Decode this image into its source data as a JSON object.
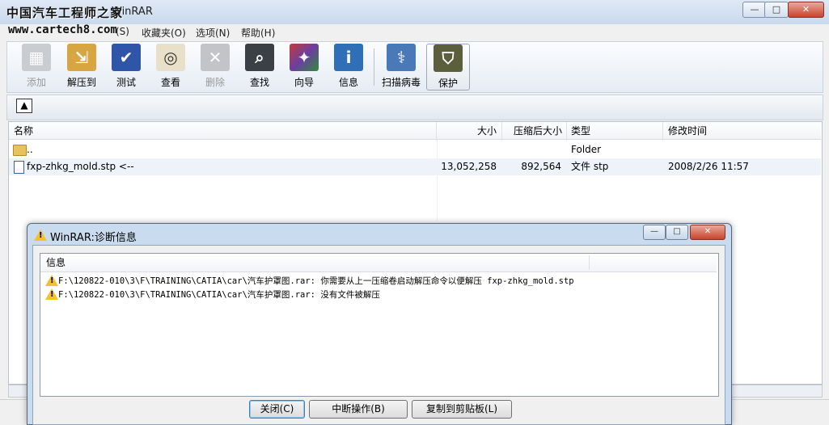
{
  "window": {
    "watermark": "中国汽车工程师之家",
    "title": "WinRAR",
    "url_watermark": "www.cartech8.com",
    "controls": {
      "minimize": "—",
      "maximize": "□",
      "close": "✕"
    }
  },
  "menubar": {
    "items": [
      "(S)",
      "收藏夹(O)",
      "选项(N)",
      "帮助(H)"
    ]
  },
  "toolbar": {
    "buttons": [
      {
        "label": "添加",
        "icon": "add-icon",
        "disabled": true
      },
      {
        "label": "解压到",
        "icon": "extract-icon"
      },
      {
        "label": "测试",
        "icon": "test-icon"
      },
      {
        "label": "查看",
        "icon": "view-icon"
      },
      {
        "label": "删除",
        "icon": "delete-icon",
        "disabled": true
      },
      {
        "label": "查找",
        "icon": "find-icon"
      },
      {
        "label": "向导",
        "icon": "wizard-icon"
      },
      {
        "label": "信息",
        "icon": "info-icon"
      },
      {
        "label": "扫描病毒",
        "icon": "virus-scan-icon"
      },
      {
        "label": "保护",
        "icon": "protect-icon"
      }
    ]
  },
  "filelist": {
    "columns": [
      "名称",
      "大小",
      "压缩后大小",
      "类型",
      "修改时间"
    ],
    "rows": [
      {
        "name": "..",
        "size": "",
        "packed": "",
        "type": "Folder",
        "modified": ""
      },
      {
        "name": "fxp-zhkg_mold.stp <--",
        "size": "13,052,258",
        "packed": "892,564",
        "type": "文件 stp",
        "modified": "2008/2/26 11:57"
      }
    ]
  },
  "dialog": {
    "title": "WinRAR:诊断信息",
    "column": "信息",
    "messages": [
      "F:\\120822-010\\3\\F\\TRAINING\\CATIA\\car\\汽车护罩图.rar: 你需要从上一压缩卷启动解压命令以便解压 fxp-zhkg_mold.stp",
      "F:\\120822-010\\3\\F\\TRAINING\\CATIA\\car\\汽车护罩图.rar: 没有文件被解压"
    ],
    "buttons": {
      "close": "关闭(C)",
      "break": "中断操作(B)",
      "copy": "复制到剪贴板(L)"
    },
    "warning_glyph": "!"
  }
}
